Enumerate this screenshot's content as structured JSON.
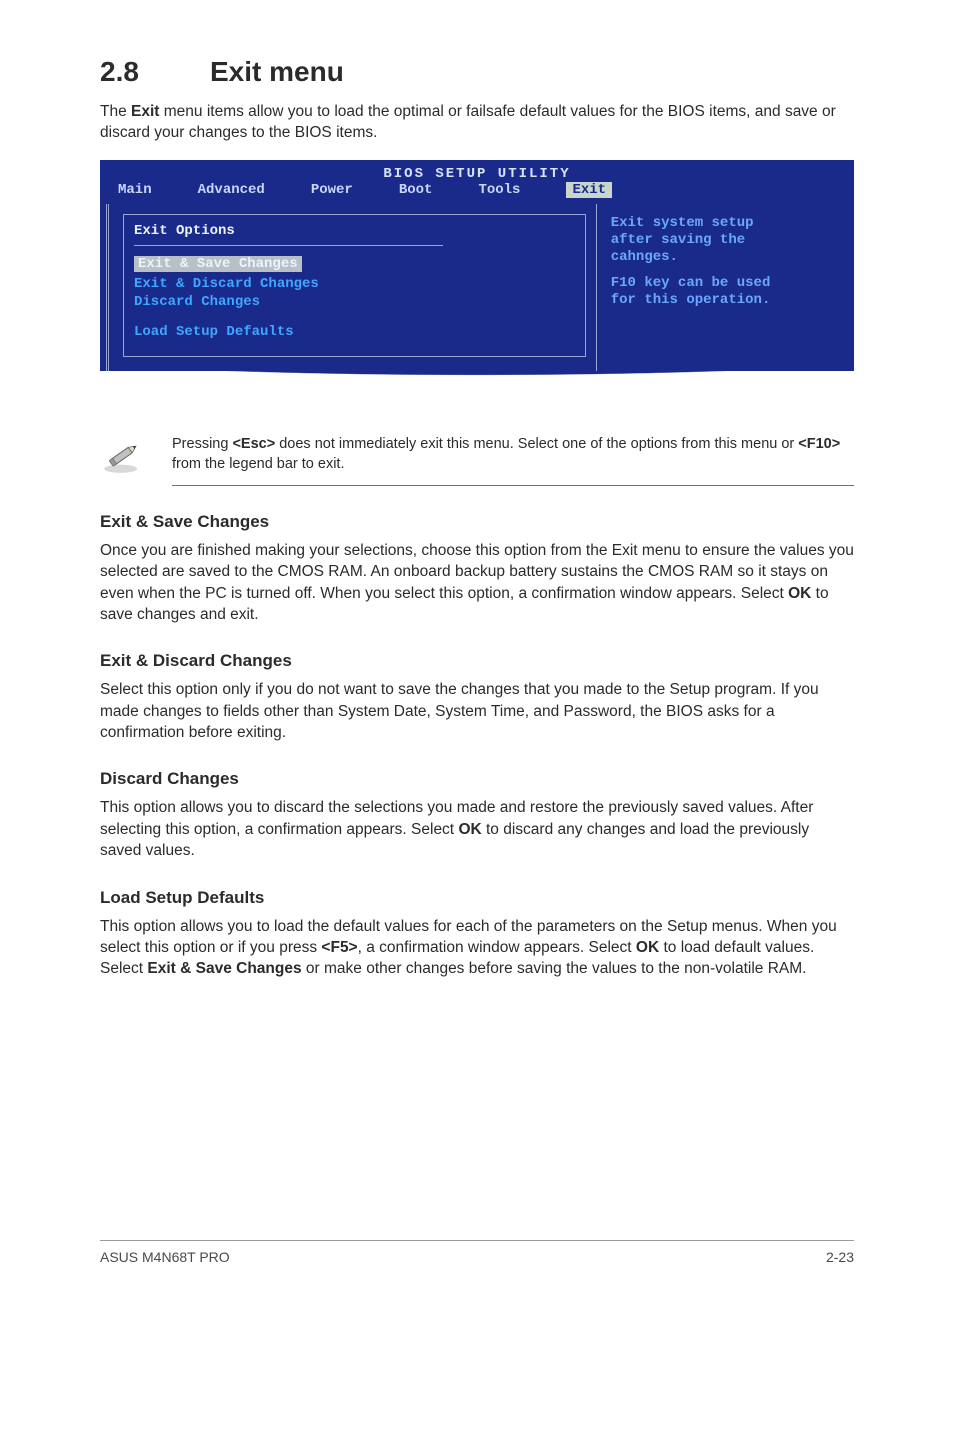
{
  "section": {
    "number": "2.8",
    "title": "Exit menu"
  },
  "intro": {
    "pre": "The ",
    "boldA": "Exit",
    "post": " menu items allow you to load the optimal or failsafe default values for the BIOS items, and save or discard your changes to the BIOS items."
  },
  "bios": {
    "title": "BIOS SETUP UTILITY",
    "tabs": {
      "main": "Main",
      "advanced": "Advanced",
      "power": "Power",
      "boot": "Boot",
      "tools": "Tools",
      "exit": "Exit"
    },
    "left": {
      "heading": "Exit Options",
      "item_selected": "Exit & Save Changes",
      "item2": "Exit & Discard Changes",
      "item3": "Discard Changes",
      "item4": "Load Setup Defaults"
    },
    "right": {
      "l1": "Exit system setup",
      "l2": "after saving the",
      "l3": "cahnges.",
      "l4": "F10 key can be used",
      "l5": "for this operation."
    }
  },
  "note": {
    "line1_pre": "Pressing ",
    "esc": "<Esc>",
    "line1_mid": " does not immediately exit this menu. Select one of the options from this menu or ",
    "f10": "<F10>",
    "line1_post": " from the legend bar to exit."
  },
  "sections": {
    "exit_save": {
      "heading": "Exit & Save Changes",
      "p_pre": "Once you are finished making your selections, choose this option from the Exit menu to ensure the values you selected are saved to the CMOS RAM. An onboard backup battery sustains the CMOS RAM so it stays on even when the PC is turned off. When you select this option, a confirmation window appears. Select ",
      "ok": "OK",
      "p_post": " to save changes and exit."
    },
    "exit_discard": {
      "heading": "Exit & Discard Changes",
      "p": "Select this option only if you do not want to save the changes that you made to the Setup program. If you made changes to fields other than System Date, System Time, and Password, the BIOS asks for a confirmation before exiting."
    },
    "discard": {
      "heading": "Discard Changes",
      "p_pre": "This option allows you to discard the selections you made and restore the previously saved values. After selecting this option, a confirmation appears. Select ",
      "ok": "OK",
      "p_post": " to discard any changes and load the previously saved values."
    },
    "load_defaults": {
      "heading": "Load Setup Defaults",
      "p_pre": "This option allows you to load the default values for each of the parameters on the Setup menus. When you select this option or if you press ",
      "f5": "<F5>",
      "p_mid1": ", a confirmation window appears. Select ",
      "ok": "OK",
      "p_mid2": " to load default values. Select ",
      "exit_save": "Exit & Save Changes",
      "p_post": " or make other changes before saving the values to the non-volatile RAM."
    }
  },
  "footer": {
    "left": "ASUS M4N68T PRO",
    "right": "2-23"
  }
}
